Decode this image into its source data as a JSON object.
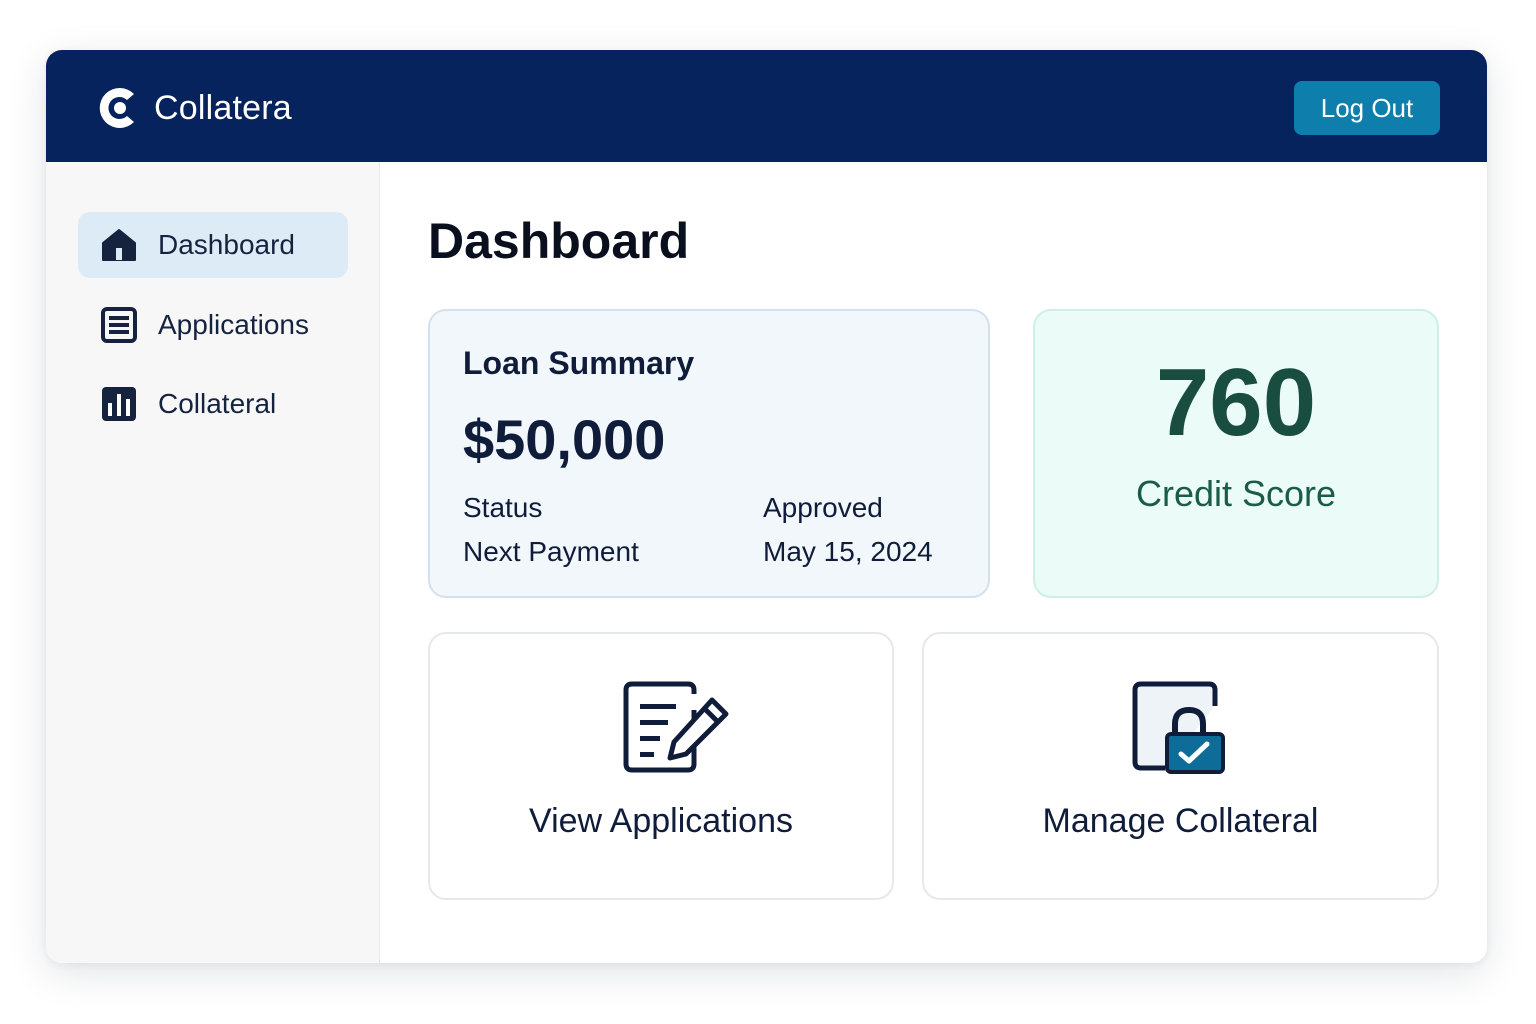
{
  "app": {
    "brand_name": "Collatera",
    "brand_logo_icon": "collatera-c-logo-icon",
    "logout_label": "Log Out"
  },
  "colors": {
    "header": "#07235d",
    "accent_button": "#0e7fad",
    "active_nav": "#dcebf6",
    "credit_text": "#184d3f",
    "credit_bg": "#eafbf8",
    "loan_bg": "#f2f7fc"
  },
  "sidebar": {
    "items": [
      {
        "label": "Dashboard",
        "icon": "home-icon",
        "active": true
      },
      {
        "label": "Applications",
        "icon": "list-icon",
        "active": false
      },
      {
        "label": "Collateral",
        "icon": "bar-chart-icon",
        "active": false
      }
    ]
  },
  "main": {
    "title": "Dashboard",
    "loan_summary": {
      "title": "Loan Summary",
      "amount": "$50,000",
      "rows": [
        {
          "label": "Status",
          "value": "Approved"
        },
        {
          "label": "Next Payment",
          "value": "May 15, 2024"
        }
      ]
    },
    "credit_score": {
      "value": "760",
      "label": "Credit Score"
    },
    "actions": [
      {
        "label": "View Applications",
        "icon": "document-edit-icon"
      },
      {
        "label": "Manage Collateral",
        "icon": "lock-document-icon"
      }
    ]
  }
}
